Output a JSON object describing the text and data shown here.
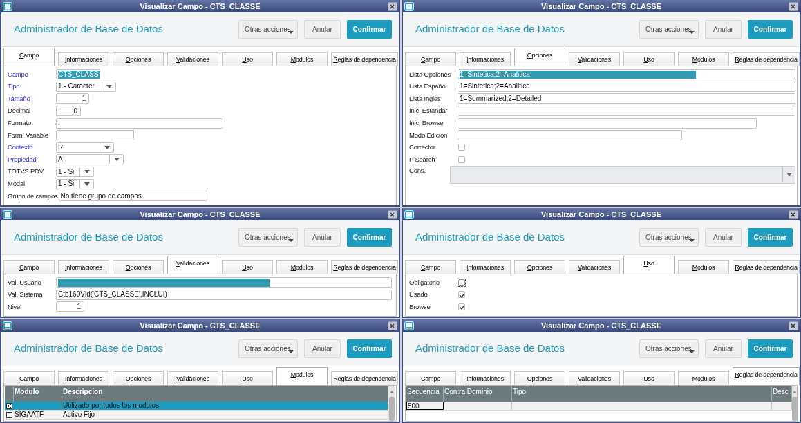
{
  "windows": [
    {
      "title": "Visualizar Campo - CTS_CLASSE",
      "header": "Administrador de Base de Datos",
      "buttons": [
        {
          "label": "Otras acciones",
          "kind": "menu"
        },
        {
          "label": "Anular",
          "kind": "secondary"
        },
        {
          "label": "Confirmar",
          "kind": "primary"
        }
      ],
      "tabs": [
        {
          "label": "Campo",
          "selected": true
        },
        {
          "label": "Informaciones",
          "selected": false
        },
        {
          "label": "Opciones",
          "selected": false
        },
        {
          "label": "Validaciones",
          "selected": false
        },
        {
          "label": "Uso",
          "selected": false
        },
        {
          "label": "Modulos",
          "selected": false
        },
        {
          "label": "Reglas de dependencia",
          "selected": false
        }
      ],
      "panel": {
        "kind": "form",
        "rows": [
          {
            "label": "Campo",
            "kind": "text",
            "value": "CTS_CLASS",
            "required": true,
            "highlighted": true
          },
          {
            "label": "Tipo",
            "kind": "select",
            "value": "1 - Caracter",
            "required": true,
            "highlighted": false
          },
          {
            "label": "Tamaño",
            "kind": "number",
            "value": "1",
            "required": true,
            "highlighted": false
          },
          {
            "label": "Decimal",
            "kind": "number",
            "value": "0",
            "required": false,
            "highlighted": false
          },
          {
            "label": "Formato",
            "kind": "text",
            "value": "!",
            "required": false,
            "highlighted": false
          },
          {
            "label": "Form. Variable",
            "kind": "text",
            "required": false,
            "highlighted": false
          },
          {
            "label": "Contexto",
            "kind": "select",
            "value": "R",
            "required": true,
            "highlighted": false
          },
          {
            "label": "Propiedad",
            "kind": "select",
            "value": "A",
            "required": true,
            "highlighted": false
          },
          {
            "label": "TOTVS PDV",
            "kind": "select",
            "value": "1 - Si",
            "required": false,
            "highlighted": false
          },
          {
            "label": "Modal",
            "kind": "select",
            "value": "1 - Si",
            "required": false,
            "highlighted": false
          },
          {
            "label": "Grupo de campos",
            "kind": "text",
            "value": "No tiene grupo de campos",
            "required": false,
            "highlighted": false
          }
        ]
      }
    },
    {
      "title": "Visualizar Campo - CTS_CLASSE",
      "header": "Administrador de Base de Datos",
      "buttons": [
        {
          "label": "Otras acciones",
          "kind": "menu"
        },
        {
          "label": "Anular",
          "kind": "secondary"
        },
        {
          "label": "Confirmar",
          "kind": "primary"
        }
      ],
      "tabs": [
        {
          "label": "Campo",
          "selected": false
        },
        {
          "label": "Informaciones",
          "selected": false
        },
        {
          "label": "Opciones",
          "selected": true
        },
        {
          "label": "Validaciones",
          "selected": false
        },
        {
          "label": "Uso",
          "selected": false
        },
        {
          "label": "Modulos",
          "selected": false
        },
        {
          "label": "Reglas de dependencia",
          "selected": false
        }
      ],
      "panel": {
        "kind": "form",
        "rows": [
          {
            "label": "Lista Opciones",
            "kind": "text",
            "value": "1=Sintetica;2=Analitica",
            "required": false,
            "highlighted": true
          },
          {
            "label": "Lista Español",
            "kind": "text",
            "value": "1=Sintetica;2=Analitica",
            "required": false,
            "highlighted": false
          },
          {
            "label": "Lista Ingles",
            "kind": "text",
            "value": "1=Summarized;2=Detailed",
            "required": false,
            "highlighted": false
          },
          {
            "label": "Inic. Estandar",
            "kind": "text",
            "required": false,
            "highlighted": false
          },
          {
            "label": "Inic. Browse",
            "kind": "text",
            "required": false,
            "highlighted": false
          },
          {
            "label": "Modo Edicion",
            "kind": "text",
            "required": false,
            "highlighted": false
          },
          {
            "label": "Corrector",
            "kind": "checkbox",
            "checked": false,
            "focused": false,
            "required": false
          },
          {
            "label": "P Search",
            "kind": "checkbox",
            "checked": false,
            "focused": false,
            "required": false
          },
          {
            "label": "Cons.",
            "kind": "lookup",
            "required": false
          }
        ]
      }
    },
    {
      "title": "Visualizar Campo - CTS_CLASSE",
      "header": "Administrador de Base de Datos",
      "buttons": [
        {
          "label": "Otras acciones",
          "kind": "menu"
        },
        {
          "label": "Anular",
          "kind": "secondary"
        },
        {
          "label": "Confirmar",
          "kind": "primary"
        }
      ],
      "tabs": [
        {
          "label": "Campo",
          "selected": false
        },
        {
          "label": "Informaciones",
          "selected": false
        },
        {
          "label": "Opciones",
          "selected": false
        },
        {
          "label": "Validaciones",
          "selected": true
        },
        {
          "label": "Uso",
          "selected": false
        },
        {
          "label": "Modulos",
          "selected": false
        },
        {
          "label": "Reglas de dependencia",
          "selected": false
        }
      ],
      "panel": {
        "kind": "form",
        "rows": [
          {
            "label": "Val. Usuario",
            "kind": "text",
            "required": false,
            "highlighted": true
          },
          {
            "label": "Val. Sistema",
            "kind": "text",
            "value": "Ctb160Vld('CTS_CLASSE',INCLUI)",
            "required": false,
            "highlighted": false
          },
          {
            "label": "Nivel",
            "kind": "number",
            "value": "1",
            "required": false,
            "highlighted": false
          }
        ]
      }
    },
    {
      "title": "Visualizar Campo - CTS_CLASSE",
      "header": "Administrador de Base de Datos",
      "buttons": [
        {
          "label": "Otras acciones",
          "kind": "menu"
        },
        {
          "label": "Anular",
          "kind": "secondary"
        },
        {
          "label": "Confirmar",
          "kind": "primary"
        }
      ],
      "tabs": [
        {
          "label": "Campo",
          "selected": false
        },
        {
          "label": "Informaciones",
          "selected": false
        },
        {
          "label": "Opciones",
          "selected": false
        },
        {
          "label": "Validaciones",
          "selected": false
        },
        {
          "label": "Uso",
          "selected": true
        },
        {
          "label": "Modulos",
          "selected": false
        },
        {
          "label": "Reglas de dependencia",
          "selected": false
        }
      ],
      "panel": {
        "kind": "form",
        "rows": [
          {
            "label": "Obligatorio",
            "kind": "checkbox",
            "checked": false,
            "focused": true,
            "required": false
          },
          {
            "label": "Usado",
            "kind": "checkbox",
            "checked": true,
            "focused": false,
            "required": false
          },
          {
            "label": "Browse",
            "kind": "checkbox",
            "checked": true,
            "focused": false,
            "required": false
          }
        ]
      }
    },
    {
      "title": "Visualizar Campo - CTS_CLASSE",
      "header": "Administrador de Base de Datos",
      "buttons": [
        {
          "label": "Otras acciones",
          "kind": "menu"
        },
        {
          "label": "Anular",
          "kind": "secondary"
        },
        {
          "label": "Confirmar",
          "kind": "primary"
        }
      ],
      "tabs": [
        {
          "label": "Campo",
          "selected": false
        },
        {
          "label": "Informaciones",
          "selected": false
        },
        {
          "label": "Opciones",
          "selected": false
        },
        {
          "label": "Validaciones",
          "selected": false
        },
        {
          "label": "Uso",
          "selected": false
        },
        {
          "label": "Modulos",
          "selected": true
        },
        {
          "label": "Reglas de dependencia",
          "selected": false
        }
      ],
      "panel": {
        "kind": "table",
        "check_column": true,
        "columns": [
          "Modulo",
          "Descripcion"
        ],
        "rows": [
          {
            "checked": true,
            "selected": true,
            "focused": false,
            "cells": [
              "",
              "Utilizado por todos los modulos"
            ]
          },
          {
            "checked": false,
            "selected": false,
            "focused": false,
            "cells": [
              "SIGAATF",
              "Activo Fijo"
            ]
          }
        ]
      }
    },
    {
      "title": "Visualizar Campo - CTS_CLASSE",
      "header": "Administrador de Base de Datos",
      "buttons": [
        {
          "label": "Otras acciones",
          "kind": "menu"
        },
        {
          "label": "Anular",
          "kind": "secondary"
        },
        {
          "label": "Confirmar",
          "kind": "primary"
        }
      ],
      "tabs": [
        {
          "label": "Campo",
          "selected": false
        },
        {
          "label": "Informaciones",
          "selected": false
        },
        {
          "label": "Opciones",
          "selected": false
        },
        {
          "label": "Validaciones",
          "selected": false
        },
        {
          "label": "Uso",
          "selected": false
        },
        {
          "label": "Modulos",
          "selected": false
        },
        {
          "label": "Reglas de dependencia",
          "selected": true
        }
      ],
      "panel": {
        "kind": "table",
        "check_column": false,
        "columns": [
          "Secuencia",
          "Contra Dominio",
          "Tipo",
          "Desc"
        ],
        "rows": [
          {
            "selected": false,
            "focused": true,
            "cells": [
              "500",
              "",
              "",
              ""
            ]
          }
        ]
      }
    }
  ]
}
